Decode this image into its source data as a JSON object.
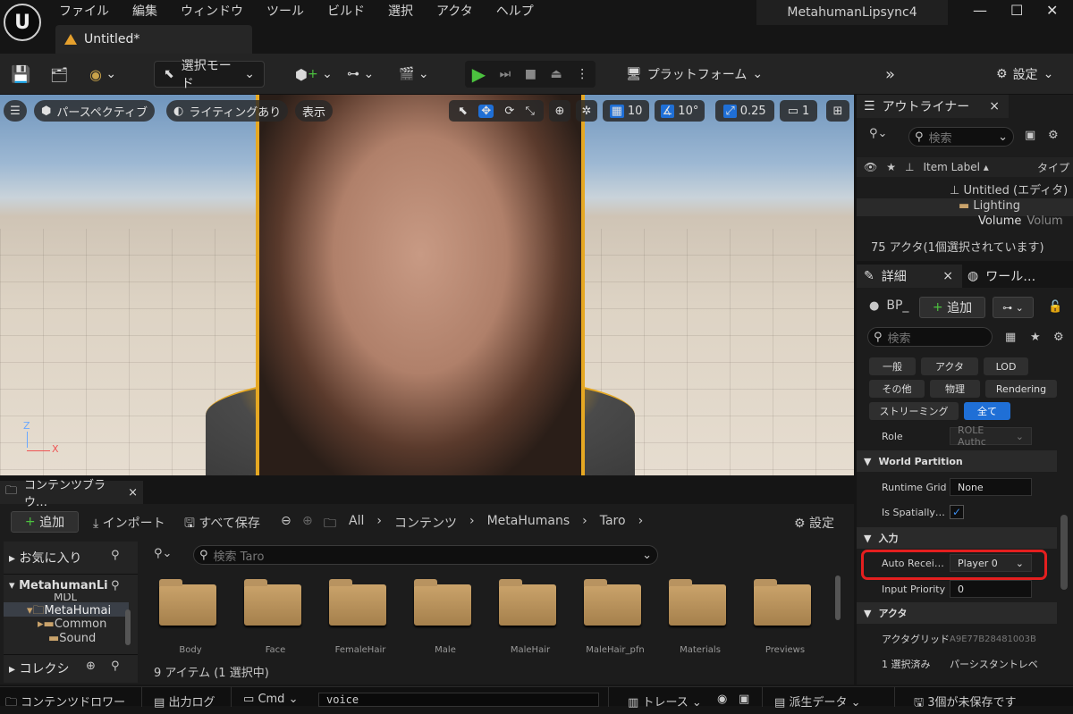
{
  "menubar": {
    "items": [
      "ファイル",
      "編集",
      "ウィンドウ",
      "ツール",
      "ビルド",
      "選択",
      "アクタ",
      "ヘルプ"
    ],
    "project": "MetahumanLipsync4",
    "logo": "U"
  },
  "window_controls": {
    "minimize": "—",
    "maximize": "☐",
    "close": "✕"
  },
  "tab": {
    "title": "Untitled*"
  },
  "toolbar": {
    "select_mode": "選択モード",
    "platform": "プラットフォーム",
    "settings": "設定"
  },
  "viewport": {
    "perspective": "パースペクティブ",
    "lighting": "ライティングあり",
    "show": "表示",
    "grid_snap": "10",
    "rot_snap": "10°",
    "scale_snap": "0.25",
    "camera_speed": "1",
    "axis_z": "Z",
    "axis_x": "X"
  },
  "outliner": {
    "title": "アウトライナー",
    "search_placeholder": "検索",
    "col_label": "Item Label ▴",
    "col_type": "タイプ",
    "rows": [
      "Untitled (エディタ)",
      "Lighting",
      "Volume"
    ],
    "row_type": "Volum",
    "status": "75 アクタ(1個選択されています)"
  },
  "details": {
    "title": "詳細",
    "world_tab": "ワール…",
    "actor_name": "BP_",
    "add": "追加",
    "search_placeholder": "検索",
    "filters": [
      "一般",
      "アクタ",
      "LOD",
      "その他",
      "物理",
      "Rendering",
      "ストリーミング",
      "全て"
    ],
    "role_label": "Role",
    "role_value": "ROLE Authc",
    "sec_world_partition": "World Partition",
    "runtime_grid_label": "Runtime Grid",
    "runtime_grid_value": "None",
    "spatially_label": "Is Spatially…",
    "sec_input": "入力",
    "auto_receive_label": "Auto Recei…",
    "auto_receive_value": "Player 0",
    "input_priority_label": "Input Priority",
    "input_priority_value": "0",
    "sec_actor": "アクタ",
    "guid_label": "アクタグリッド",
    "guid_value": "A9E77B28481003B",
    "selected_label": "1 選択済み",
    "selected_value": "パーシスタントレベ"
  },
  "content": {
    "title": "コンテンツブラウ…",
    "add": "追加",
    "import": "インポート",
    "save_all": "すべて保存",
    "path": [
      "All",
      "コンテンツ",
      "MetaHumans",
      "Taro"
    ],
    "settings": "設定",
    "favorites": "お気に入り",
    "tree_root": "MetahumanLi",
    "tree_items": [
      "MDL",
      "MetaHumai",
      "Common",
      "Sound"
    ],
    "collections": "コレクシ",
    "search_placeholder": "検索 Taro",
    "folders": [
      "Body",
      "Face",
      "FemaleHair",
      "Male",
      "MaleHair",
      "MaleHair_pfn",
      "Materials",
      "Previews"
    ],
    "status": "9 アイテム (1 選択中)"
  },
  "bottom": {
    "drawer": "コンテンツドロワー",
    "output_log": "出力ログ",
    "cmd": "Cmd",
    "console_value": "voice",
    "trace": "トレース",
    "derived": "派生データ",
    "unsaved": "3個が未保存です"
  }
}
